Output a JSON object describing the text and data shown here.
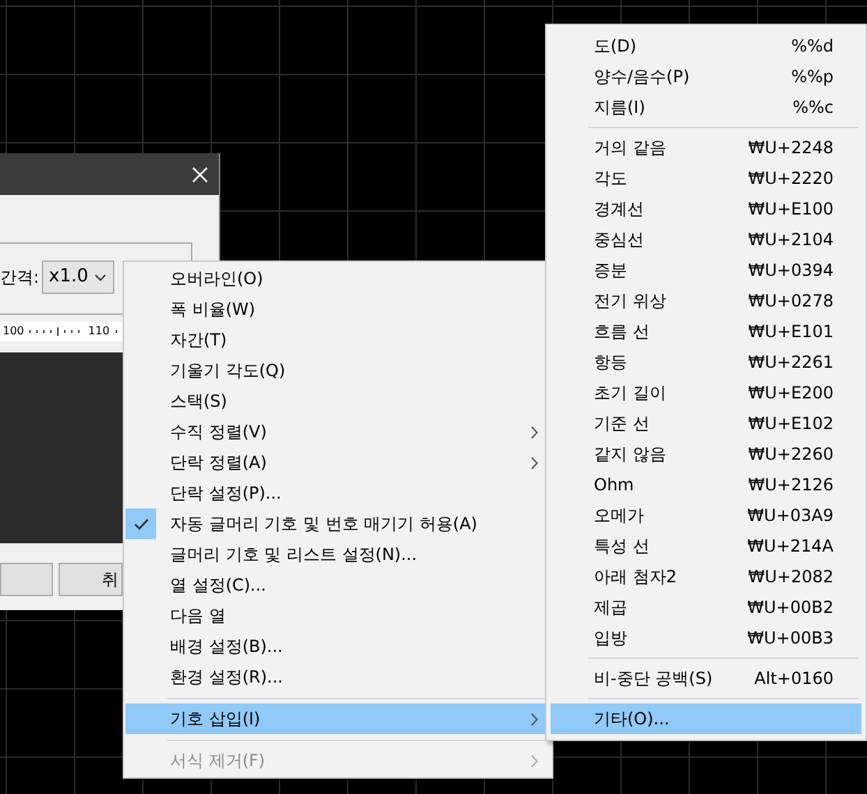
{
  "dialog": {
    "spacing_label": "간격:",
    "spacing_value": "x1.0",
    "ruler_labels": [
      "100",
      "110"
    ],
    "buttons": [
      {
        "kind": "blank"
      },
      {
        "kind": "text",
        "label": "취"
      }
    ]
  },
  "context_menu": {
    "items": [
      {
        "kind": "item",
        "label": "오버라인(O)",
        "checked": false,
        "submenu": false,
        "disabled": false,
        "selected": false
      },
      {
        "kind": "item",
        "label": "폭 비율(W)",
        "checked": false,
        "submenu": false,
        "disabled": false,
        "selected": false
      },
      {
        "kind": "item",
        "label": "자간(T)",
        "checked": false,
        "submenu": false,
        "disabled": false,
        "selected": false
      },
      {
        "kind": "item",
        "label": "기울기 각도(Q)",
        "checked": false,
        "submenu": false,
        "disabled": false,
        "selected": false
      },
      {
        "kind": "item",
        "label": "스택(S)",
        "checked": false,
        "submenu": false,
        "disabled": false,
        "selected": false
      },
      {
        "kind": "item",
        "label": "수직 정렬(V)",
        "checked": false,
        "submenu": true,
        "disabled": false,
        "selected": false
      },
      {
        "kind": "item",
        "label": "단락 정렬(A)",
        "checked": false,
        "submenu": true,
        "disabled": false,
        "selected": false
      },
      {
        "kind": "item",
        "label": "단락 설정(P)...",
        "checked": false,
        "submenu": false,
        "disabled": false,
        "selected": false
      },
      {
        "kind": "item",
        "label": "자동 글머리 기호 및 번호 매기기 허용(A)",
        "checked": true,
        "submenu": false,
        "disabled": false,
        "selected": false
      },
      {
        "kind": "item",
        "label": "글머리 기호 및 리스트 설정(N)...",
        "checked": false,
        "submenu": false,
        "disabled": false,
        "selected": false
      },
      {
        "kind": "item",
        "label": "열 설정(C)...",
        "checked": false,
        "submenu": false,
        "disabled": false,
        "selected": false
      },
      {
        "kind": "item",
        "label": "다음 열",
        "checked": false,
        "submenu": false,
        "disabled": false,
        "selected": false
      },
      {
        "kind": "item",
        "label": "배경 설정(B)...",
        "checked": false,
        "submenu": false,
        "disabled": false,
        "selected": false
      },
      {
        "kind": "item",
        "label": "환경 설정(R)...",
        "checked": false,
        "submenu": false,
        "disabled": false,
        "selected": false
      },
      {
        "kind": "separator"
      },
      {
        "kind": "item",
        "label": "기호 삽입(I)",
        "checked": false,
        "submenu": true,
        "disabled": false,
        "selected": true
      },
      {
        "kind": "separator"
      },
      {
        "kind": "item",
        "label": "서식 제거(F)",
        "checked": false,
        "submenu": true,
        "disabled": true,
        "selected": false
      }
    ]
  },
  "submenu": {
    "items": [
      {
        "kind": "item",
        "label": "도(D)",
        "shortcut": "%%d",
        "selected": false
      },
      {
        "kind": "item",
        "label": "양수/음수(P)",
        "shortcut": "%%p",
        "selected": false
      },
      {
        "kind": "item",
        "label": "지름(I)",
        "shortcut": "%%c",
        "selected": false
      },
      {
        "kind": "separator"
      },
      {
        "kind": "item",
        "label": "거의 같음",
        "shortcut": "₩U+2248",
        "selected": false
      },
      {
        "kind": "item",
        "label": "각도",
        "shortcut": "₩U+2220",
        "selected": false
      },
      {
        "kind": "item",
        "label": "경계선",
        "shortcut": "₩U+E100",
        "selected": false
      },
      {
        "kind": "item",
        "label": "중심선",
        "shortcut": "₩U+2104",
        "selected": false
      },
      {
        "kind": "item",
        "label": "증분",
        "shortcut": "₩U+0394",
        "selected": false
      },
      {
        "kind": "item",
        "label": "전기 위상",
        "shortcut": "₩U+0278",
        "selected": false
      },
      {
        "kind": "item",
        "label": "흐름 선",
        "shortcut": "₩U+E101",
        "selected": false
      },
      {
        "kind": "item",
        "label": "항등",
        "shortcut": "₩U+2261",
        "selected": false
      },
      {
        "kind": "item",
        "label": "초기 길이",
        "shortcut": "₩U+E200",
        "selected": false
      },
      {
        "kind": "item",
        "label": "기준 선",
        "shortcut": "₩U+E102",
        "selected": false
      },
      {
        "kind": "item",
        "label": "같지 않음",
        "shortcut": "₩U+2260",
        "selected": false
      },
      {
        "kind": "item",
        "label": "Ohm",
        "shortcut": "₩U+2126",
        "selected": false
      },
      {
        "kind": "item",
        "label": "오메가",
        "shortcut": "₩U+03A9",
        "selected": false
      },
      {
        "kind": "item",
        "label": "특성 선",
        "shortcut": "₩U+214A",
        "selected": false
      },
      {
        "kind": "item",
        "label": "아래 첨자2",
        "shortcut": "₩U+2082",
        "selected": false
      },
      {
        "kind": "item",
        "label": "제곱",
        "shortcut": "₩U+00B2",
        "selected": false
      },
      {
        "kind": "item",
        "label": "입방",
        "shortcut": "₩U+00B3",
        "selected": false
      },
      {
        "kind": "separator"
      },
      {
        "kind": "item",
        "label": "비-중단 공백(S)",
        "shortcut": "Alt+0160",
        "selected": false
      },
      {
        "kind": "separator"
      },
      {
        "kind": "item",
        "label": "기타(O)...",
        "selected": true
      }
    ]
  }
}
